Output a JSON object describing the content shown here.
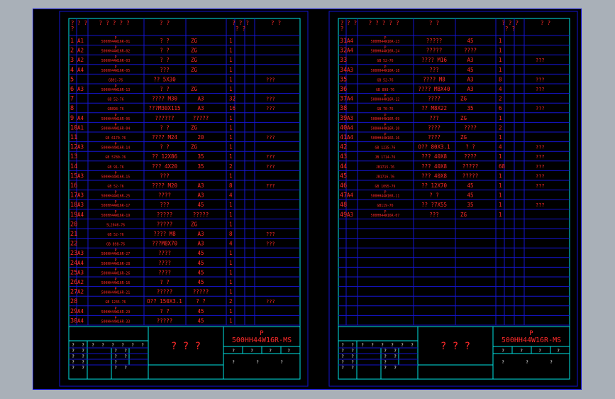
{
  "colors": {
    "frame": "#1515d0",
    "cyan": "#00e5e5",
    "red": "#ff2a2a",
    "bg": "#000000",
    "paper": "#a9b0b8"
  },
  "sheet_left": {
    "headers": [
      "?\n?",
      "? ?",
      "? ? ? ? ?",
      "? ?",
      "? ? ?\n? ?",
      "? ?"
    ],
    "rows": [
      {
        "no": "1",
        "sz": "A1",
        "code": "500HH44W16R-01",
        "name": "? ?",
        "mat": "ZG",
        "qty": "1",
        "note": ""
      },
      {
        "no": "2",
        "sz": "A2",
        "code": "500HH44W16R-02",
        "name": "? ?",
        "mat": "ZG",
        "qty": "1",
        "note": ""
      },
      {
        "no": "3",
        "sz": "A2",
        "code": "500HH44W16R-03",
        "name": "? ?",
        "mat": "ZG",
        "qty": "1",
        "note": ""
      },
      {
        "no": "4",
        "sz": "A4",
        "code": "500HH44W16R-05",
        "name": "???",
        "mat": "ZG",
        "qty": "1",
        "note": ""
      },
      {
        "no": "5",
        "sz": "",
        "code": "GB91-76",
        "name": "??  5X30",
        "mat": "",
        "qty": "1",
        "note": "???"
      },
      {
        "no": "6",
        "sz": "A3",
        "code": "500HH44W16R-13",
        "name": "? ?",
        "mat": "ZG",
        "qty": "1",
        "note": ""
      },
      {
        "no": "7",
        "sz": "",
        "code": "GB 52-76",
        "name": "????  M30",
        "mat": "A3",
        "qty": "32",
        "note": "???"
      },
      {
        "no": "8",
        "sz": "",
        "code": "GB898-76",
        "name": "???M30X115",
        "mat": "A3",
        "qty": "16",
        "note": "???"
      },
      {
        "no": "9",
        "sz": "A4",
        "code": "500HH44W16R-06",
        "name": "??????",
        "mat": "?????",
        "qty": "1",
        "note": ""
      },
      {
        "no": "10",
        "sz": "A1",
        "code": "500HH44W16R-04",
        "name": "? ?",
        "mat": "ZG",
        "qty": "1",
        "note": ""
      },
      {
        "no": "11",
        "sz": "",
        "code": "GB 6170-76",
        "name": "????  M24",
        "mat": "20",
        "qty": "1",
        "note": "???"
      },
      {
        "no": "12",
        "sz": "A3",
        "code": "500HH44W16R-14",
        "name": "? ?",
        "mat": "ZG",
        "qty": "1",
        "note": ""
      },
      {
        "no": "13",
        "sz": "",
        "code": "GB 5780-76",
        "name": "??  12X86",
        "mat": "35",
        "qty": "1",
        "note": "???"
      },
      {
        "no": "14",
        "sz": "",
        "code": "GB 91-76",
        "name": "???  4X20",
        "mat": "35",
        "qty": "2",
        "note": "???"
      },
      {
        "no": "15",
        "sz": "A3",
        "code": "500HH44W16R-15",
        "name": "???",
        "mat": "",
        "qty": "1",
        "note": ""
      },
      {
        "no": "16",
        "sz": "",
        "code": "GB 52-76",
        "name": "????  M20",
        "mat": "A3",
        "qty": "8",
        "note": "???"
      },
      {
        "no": "17",
        "sz": "A3",
        "code": "500HH44W16R-25",
        "name": "????",
        "mat": "A3",
        "qty": "4",
        "note": ""
      },
      {
        "no": "18",
        "sz": "A3",
        "code": "500HH44W16R-17",
        "name": "???",
        "mat": "45",
        "qty": "1",
        "note": ""
      },
      {
        "no": "19",
        "sz": "A4",
        "code": "500HH44W16R-19",
        "name": "?????",
        "mat": "?????",
        "qty": "1",
        "note": ""
      },
      {
        "no": "20",
        "sz": "",
        "code": "SL2046-76",
        "name": "?????",
        "mat": "ZG",
        "qty": "1",
        "note": ""
      },
      {
        "no": "21",
        "sz": "",
        "code": "GB 52-76",
        "name": "????  M8",
        "mat": "A3",
        "qty": "8",
        "note": "???"
      },
      {
        "no": "22",
        "sz": "",
        "code": "GB 898-76",
        "name": "???M8X70",
        "mat": "A3",
        "qty": "4",
        "note": "???"
      },
      {
        "no": "23",
        "sz": "A3",
        "code": "500HH44W16R-27",
        "name": "????",
        "mat": "45",
        "qty": "1",
        "note": ""
      },
      {
        "no": "24",
        "sz": "A4",
        "code": "500HH44W16R-28",
        "name": "????",
        "mat": "45",
        "qty": "1",
        "note": ""
      },
      {
        "no": "25",
        "sz": "A3",
        "code": "500HH44W16R-26",
        "name": "????",
        "mat": "45",
        "qty": "1",
        "note": ""
      },
      {
        "no": "26",
        "sz": "A2",
        "code": "500HH44W16R-16",
        "name": "? ?",
        "mat": "45",
        "qty": "1",
        "note": ""
      },
      {
        "no": "27",
        "sz": "A2",
        "code": "500HH44W16R-21",
        "name": "?????",
        "mat": "?????",
        "qty": "1",
        "note": ""
      },
      {
        "no": "28",
        "sz": "",
        "code": "GB 1235-76",
        "name": "O??  150X3.1",
        "mat": "? ?",
        "qty": "2",
        "note": "???"
      },
      {
        "no": "29",
        "sz": "A4",
        "code": "500HH44W16R-29",
        "name": "? ?",
        "mat": "45",
        "qty": "1",
        "note": ""
      },
      {
        "no": "30",
        "sz": "A4",
        "code": "500HH44W16R-33",
        "name": "?????",
        "mat": "45",
        "qty": "1",
        "note": ""
      }
    ],
    "title_block": {
      "drawing_no": "500HH44W16R-MS",
      "mark": "P",
      "name": "? ? ?",
      "small": "?"
    }
  },
  "sheet_right": {
    "headers": [
      "?\n?",
      "? ?",
      "? ? ? ? ?",
      "? ?",
      "? ? ?\n? ?",
      "? ?"
    ],
    "rows": [
      {
        "no": "31",
        "sz": "A4",
        "code": "500HH44W16R-23",
        "name": "?????",
        "mat": "45",
        "qty": "1",
        "note": ""
      },
      {
        "no": "32",
        "sz": "A4",
        "code": "500HH44W16R-24",
        "name": "?????",
        "mat": "????",
        "qty": "1",
        "note": ""
      },
      {
        "no": "33",
        "sz": "",
        "code": "GB 52-76",
        "name": "????  M16",
        "mat": "A3",
        "qty": "1",
        "note": "???"
      },
      {
        "no": "34",
        "sz": "A3",
        "code": "500HH44W16R-18",
        "name": "???",
        "mat": "45",
        "qty": "1",
        "note": ""
      },
      {
        "no": "35",
        "sz": "",
        "code": "GB 52-76",
        "name": "????  M8",
        "mat": "A3",
        "qty": "8",
        "note": "???"
      },
      {
        "no": "36",
        "sz": "",
        "code": "GB 898-76",
        "name": "????  M8X40",
        "mat": "A3",
        "qty": "4",
        "note": "???"
      },
      {
        "no": "37",
        "sz": "A4",
        "code": "500HH44W16R-12",
        "name": "????",
        "mat": "ZG",
        "qty": "2",
        "note": ""
      },
      {
        "no": "38",
        "sz": "",
        "code": "GB 70-76",
        "name": "??  M8X22",
        "mat": "35",
        "qty": "6",
        "note": "???"
      },
      {
        "no": "39",
        "sz": "A3",
        "code": "500HH44W16R-09",
        "name": "???",
        "mat": "ZG",
        "qty": "1",
        "note": ""
      },
      {
        "no": "40",
        "sz": "A4",
        "code": "500HH44W16R-10",
        "name": "????",
        "mat": "????",
        "qty": "2",
        "note": ""
      },
      {
        "no": "41",
        "sz": "A4",
        "code": "500HH44W16R-16",
        "name": "????",
        "mat": "ZG",
        "qty": "1",
        "note": ""
      },
      {
        "no": "42",
        "sz": "",
        "code": "GB 1235-76",
        "name": "O??  80X3.1",
        "mat": "? ?",
        "qty": "4",
        "note": "???"
      },
      {
        "no": "43",
        "sz": "",
        "code": "JB 1714-76",
        "name": "???  40X8",
        "mat": "????",
        "qty": "1",
        "note": "???"
      },
      {
        "no": "44",
        "sz": "",
        "code": "JB1715-76",
        "name": "???  40X8",
        "mat": "?????",
        "qty": "68",
        "note": "???"
      },
      {
        "no": "45",
        "sz": "",
        "code": "JB1716-76",
        "name": "???  40X8",
        "mat": "?????",
        "qty": "1",
        "note": "???"
      },
      {
        "no": "46",
        "sz": "",
        "code": "GB 1095-79",
        "name": "??  12X70",
        "mat": "45",
        "qty": "1",
        "note": "???"
      },
      {
        "no": "47",
        "sz": "A4",
        "code": "500HH44W16R-11",
        "name": "? ?",
        "mat": "45",
        "qty": "1",
        "note": ""
      },
      {
        "no": "48",
        "sz": "",
        "code": "GB119-76",
        "name": "??  ?7X55",
        "mat": "35",
        "qty": "1",
        "note": "???"
      },
      {
        "no": "49",
        "sz": "A3",
        "code": "500HH44W16R-07",
        "name": "???",
        "mat": "ZG",
        "qty": "1",
        "note": ""
      }
    ],
    "title_block": {
      "drawing_no": "500HH44W16R-MS",
      "mark": "P",
      "name": "? ? ?",
      "small": "?"
    }
  }
}
